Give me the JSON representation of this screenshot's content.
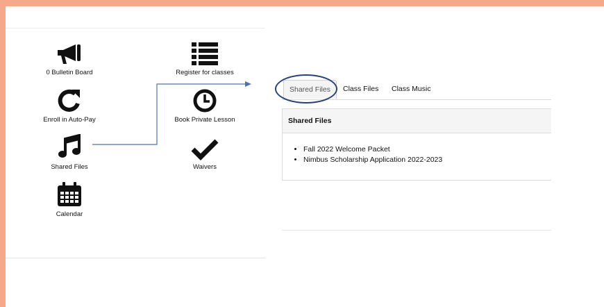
{
  "colors": {
    "frame": "#f5a88a",
    "connector": "#4a72b8",
    "highlight_ring": "#23427e",
    "icon": "#111111"
  },
  "dashboard": {
    "tiles": [
      {
        "icon": "megaphone-icon",
        "label": "0 Bulletin Board"
      },
      {
        "icon": "list-icon",
        "label": "Register for classes"
      },
      {
        "icon": "refresh-icon",
        "label": "Enroll in Auto-Pay"
      },
      {
        "icon": "clock-icon",
        "label": "Book Private Lesson"
      },
      {
        "icon": "music-note-icon",
        "label": "Shared Files"
      },
      {
        "icon": "checkmark-icon",
        "label": "Waivers"
      },
      {
        "icon": "calendar-icon",
        "label": "Calendar"
      }
    ]
  },
  "files_view": {
    "tabs": [
      {
        "label": "Shared Files",
        "active": true
      },
      {
        "label": "Class Files",
        "active": false
      },
      {
        "label": "Class Music",
        "active": false
      }
    ],
    "panel_title": "Shared Files",
    "files": [
      "Fall 2022 Welcome Packet",
      "Nimbus Scholarship Application 2022-2023"
    ]
  }
}
